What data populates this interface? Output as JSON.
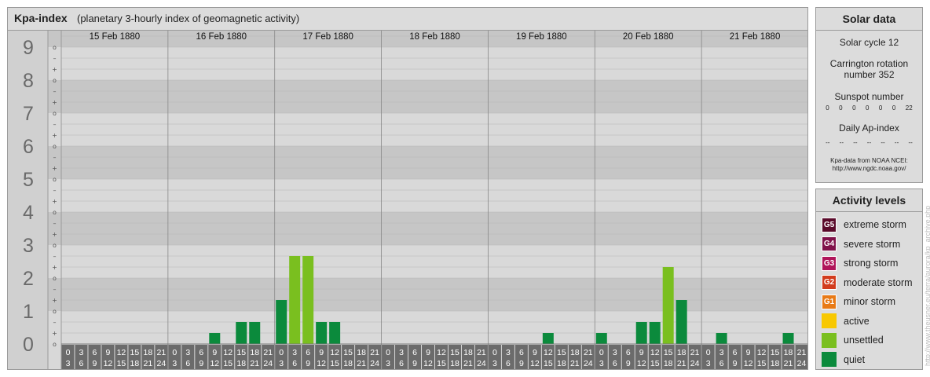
{
  "header": {
    "title": "Kpa-index",
    "subtitle": "(planetary 3-hourly index of geomagnetic activity)"
  },
  "chart_data": {
    "type": "bar",
    "y_levels": [
      "0",
      "1",
      "2",
      "3",
      "4",
      "5",
      "6",
      "7",
      "8",
      "9"
    ],
    "y_sublabels": [
      "o",
      "+",
      "–",
      "o",
      "+",
      "–",
      "o",
      "+",
      "–",
      "o",
      "+",
      "–",
      "o",
      "+",
      "–",
      "o",
      "+",
      "–",
      "o",
      "+",
      "–",
      "o",
      "+",
      "–",
      "o",
      "+",
      "–",
      "o"
    ],
    "ylim": [
      0,
      9.33
    ],
    "hour_starts": [
      "0",
      "3",
      "6",
      "9",
      "12",
      "15",
      "18",
      "21"
    ],
    "hour_ends": [
      "3",
      "6",
      "9",
      "12",
      "15",
      "18",
      "21",
      "24"
    ],
    "days": [
      {
        "date": "15 Feb 1880",
        "values": [
          0,
          0,
          0,
          0,
          0,
          0,
          0,
          0
        ]
      },
      {
        "date": "16 Feb 1880",
        "values": [
          0,
          0,
          0,
          0.333,
          0,
          0.667,
          0.667,
          0
        ]
      },
      {
        "date": "17 Feb 1880",
        "values": [
          1.333,
          2.667,
          2.667,
          0.667,
          0.667,
          0,
          0,
          0
        ]
      },
      {
        "date": "18 Feb 1880",
        "values": [
          0,
          0,
          0,
          0,
          0,
          0,
          0,
          0
        ]
      },
      {
        "date": "19 Feb 1880",
        "values": [
          0,
          0,
          0,
          0,
          0.333,
          0,
          0,
          0
        ]
      },
      {
        "date": "20 Feb 1880",
        "values": [
          0.333,
          0,
          0,
          0.667,
          0.667,
          2.333,
          1.333,
          0
        ]
      },
      {
        "date": "21 Feb 1880",
        "values": [
          0,
          0.333,
          0,
          0,
          0,
          0,
          0.333,
          0
        ]
      }
    ],
    "grid": true
  },
  "colors": {
    "quiet": "#0b8a3c",
    "unsettled": "#7abf1f",
    "active": "#f8c800",
    "band_dark": "#c6c6c6",
    "band_light": "#d9d9d9",
    "hour_cell": "#6b6b6b",
    "axis_cell": "#a8a8a8"
  },
  "solar": {
    "title": "Solar data",
    "cycle": "Solar cycle 12",
    "carrington": "Carrington rotation number 352",
    "sunspot_label": "Sunspot number",
    "sunspots": [
      "0",
      "0",
      "0",
      "0",
      "0",
      "0",
      "22"
    ],
    "ap_label": "Daily Ap-index",
    "ap_values": [
      "--",
      "--",
      "--",
      "--",
      "--",
      "--",
      "--"
    ],
    "source_line1": "Kpa-data from NOAA NCEI:",
    "source_line2": "http://www.ngdc.noaa.gov/"
  },
  "activity": {
    "title": "Activity levels",
    "items": [
      {
        "badge": "G5",
        "label": "extreme storm",
        "color": "#5a0a2a"
      },
      {
        "badge": "G4",
        "label": "severe storm",
        "color": "#80124a"
      },
      {
        "badge": "G3",
        "label": "strong storm",
        "color": "#b0155a"
      },
      {
        "badge": "G2",
        "label": "moderate storm",
        "color": "#d23c1e"
      },
      {
        "badge": "G1",
        "label": "minor storm",
        "color": "#e87a16"
      },
      {
        "badge": "",
        "label": "active",
        "color": "#f8c800"
      },
      {
        "badge": "",
        "label": "unsettled",
        "color": "#7abf1f"
      },
      {
        "badge": "",
        "label": "quiet",
        "color": "#0b8a3c"
      }
    ]
  },
  "watermark": "http://www.theusner.eu/terra/aurora/kp_archive.php"
}
